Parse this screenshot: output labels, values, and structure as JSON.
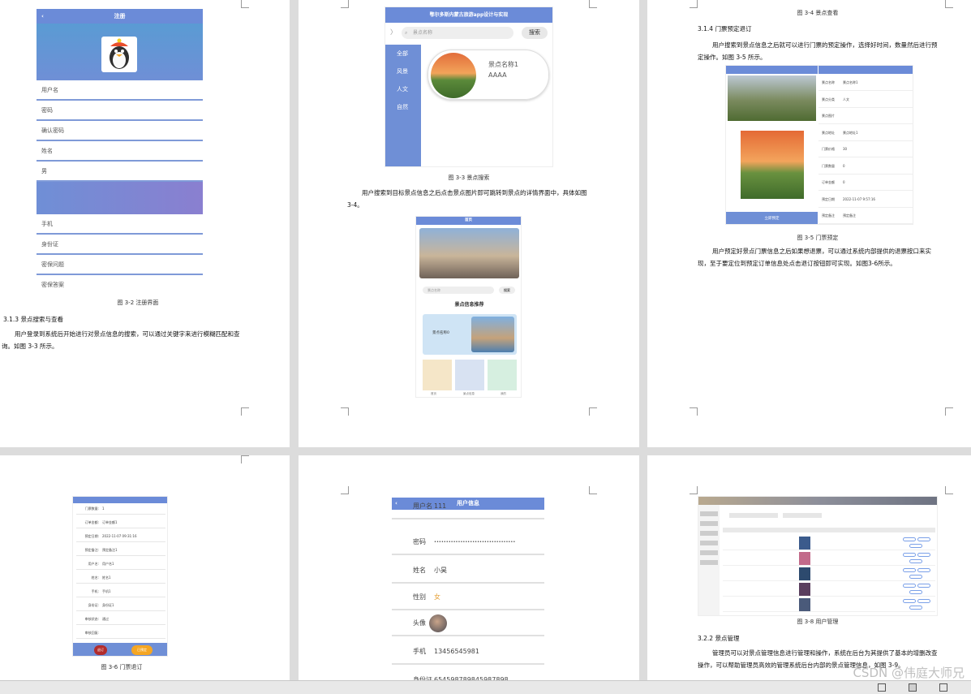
{
  "page1": {
    "register_title": "注册",
    "fields": [
      "用户名",
      "密码",
      "确认密码",
      "姓名",
      "男",
      "手机",
      "身份证",
      "密保问题",
      "密保答案"
    ],
    "caption": "图 3-2 注册界面",
    "section": "3.1.3 景点搜索与查看",
    "text": "用户登录到系统后开始进行对景点信息的搜索，可以通过关键字来进行模糊匹配和查询。如图 3-3 所示。"
  },
  "page2": {
    "app_title": "鄂尔多斯内蒙古旅游app设计与实现",
    "search_placeholder": "景点名称",
    "search_button": "搜索",
    "categories": [
      "全部",
      "风景",
      "人文",
      "自然"
    ],
    "spot_name": "景点名称1",
    "spot_level": "AAAA",
    "caption": "图 3-3 景点搜索",
    "text": "用户搜索到目标景点信息之后点击景点图片即可跳转到景点的详情界面中，具体如图 3-4。",
    "home_title": "首页",
    "home_search": "景点名称",
    "home_search_btn": "搜索",
    "recommend_title": "景点信息推荐",
    "recommend_item": "景点名称0",
    "nav": [
      "首页",
      "景点信息",
      "我的"
    ]
  },
  "page3": {
    "top_caption": "图 3-4 景点查看",
    "section": "3.1.4 门票预定退订",
    "text": "用户搜索到景点信息之后就可以进行门票的预定操作，选择好时间，数量然后进行预定操作。如图 3-5 所示。",
    "detail_labels": [
      "景点名称",
      "景点分类",
      "景点图片",
      "景点地址",
      "门票价格",
      "门票数量",
      "订单金额",
      "预定日期",
      "预定备注"
    ],
    "detail_values": [
      "景点名称1",
      "人文",
      "",
      "景点地址1",
      "30",
      "0",
      "0",
      "2022-11-07 9:57:16",
      "预定备注"
    ],
    "book_button": "立即预定",
    "caption": "图 3-5 门票预定",
    "text2": "用户预定好景点门票信息之后如果想退票，可以通过系统内部提供的退票按口来实现，至于要定位到预定订单信息处点击退订按钮即可实现。如图3-6所示。"
  },
  "page4": {
    "rows": [
      [
        "门票数量",
        "1"
      ],
      [
        "订单金额",
        "订单金额1"
      ],
      [
        "预定日期",
        "2022-11-07 09:31:16"
      ],
      [
        "预定备注",
        "预定备注1"
      ],
      [
        "用户名",
        "用户名1"
      ],
      [
        "姓名",
        "姓名1"
      ],
      [
        "手机",
        "手机1"
      ],
      [
        "身份证",
        "身份证1"
      ],
      [
        "审核状态",
        "通过"
      ],
      [
        "审核回复",
        ""
      ]
    ],
    "btn_cancel": "退订",
    "btn_back": "已预定",
    "caption": "图 3-6 门票退订"
  },
  "page5": {
    "title": "用户信息",
    "rows": [
      [
        "用户名",
        "111"
      ],
      [
        "密码",
        "••••••••••••••••••••••••••••••••••"
      ],
      [
        "姓名",
        "小昊"
      ],
      [
        "性别",
        "女"
      ],
      [
        "头像",
        ""
      ],
      [
        "手机",
        "13456545981"
      ],
      [
        "身份证",
        "654598789845987898"
      ]
    ]
  },
  "page6": {
    "caption": "图 3-8 用户管理",
    "section": "3.2.2 景点管理",
    "text": "管理员可以对景点管理信息进行管理和操作，系统在后台为其提供了基本的增删改查操作，可以帮助管理员高效的管理系统后台内部的景点管理信息，如图 3-9。"
  },
  "watermark": "CSDN @伟庭大师兄"
}
